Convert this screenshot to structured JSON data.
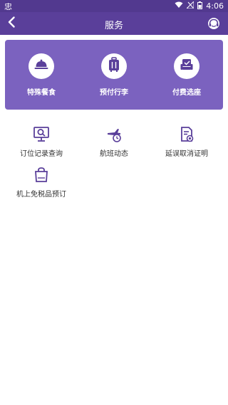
{
  "status_bar": {
    "left_glyph": "忠",
    "time": "4:06"
  },
  "header": {
    "title": "服务"
  },
  "panel": {
    "items": [
      {
        "label": "特殊餐食",
        "icon": "food-cloche-icon"
      },
      {
        "label": "预付行李",
        "icon": "luggage-icon"
      },
      {
        "label": "付费选座",
        "icon": "seat-icon"
      }
    ]
  },
  "grid": {
    "items": [
      {
        "label": "订位记录查询",
        "icon": "monitor-search-icon"
      },
      {
        "label": "航班动态",
        "icon": "plane-clock-icon"
      },
      {
        "label": "延误取消证明",
        "icon": "document-certificate-icon"
      },
      {
        "label": "机上免税品预订",
        "icon": "shopping-bag-icon"
      }
    ]
  },
  "colors": {
    "status_bar": "#52398f",
    "header": "#5a3f9a",
    "panel": "#7b62bf",
    "icon": "#5a3f9a"
  }
}
